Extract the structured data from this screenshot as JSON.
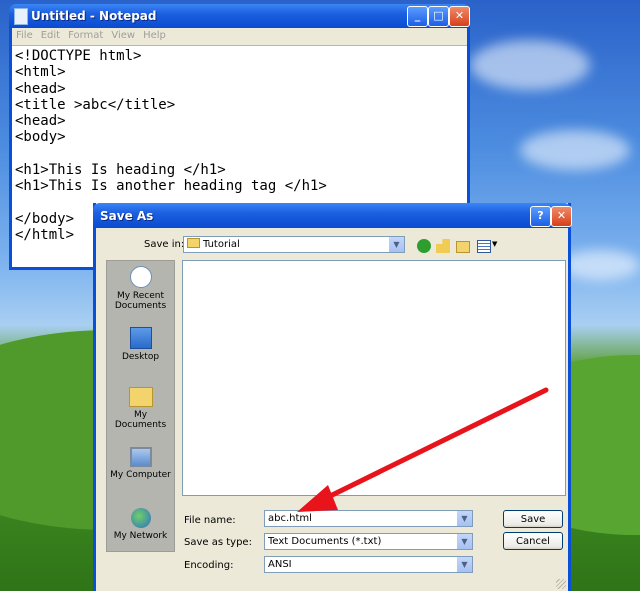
{
  "notepad": {
    "title": "Untitled - Notepad",
    "menu": [
      "File",
      "Edit",
      "Format",
      "View",
      "Help"
    ],
    "content": "<!DOCTYPE html>\n<html>\n<head>\n<title >abc</title>\n<head>\n<body>\n\n<h1>This Is heading </h1>\n<h1>This Is another heading tag </h1>\n\n</body>\n</html>"
  },
  "save_dialog": {
    "title": "Save As",
    "save_in_label": "Save in:",
    "save_in_value": "Tutorial",
    "places": [
      {
        "label": "My Recent Documents",
        "icon": "recent-documents-icon"
      },
      {
        "label": "Desktop",
        "icon": "desktop-icon"
      },
      {
        "label": "My Documents",
        "icon": "my-documents-icon"
      },
      {
        "label": "My Computer",
        "icon": "my-computer-icon"
      },
      {
        "label": "My Network",
        "icon": "my-network-icon"
      }
    ],
    "file_name_label": "File name:",
    "file_name_value": "abc.html",
    "save_as_type_label": "Save as type:",
    "save_as_type_value": "Text Documents (*.txt)",
    "encoding_label": "Encoding:",
    "encoding_value": "ANSI",
    "save_button": "Save",
    "cancel_button": "Cancel",
    "title_buttons": {
      "help": "?",
      "close": "✕"
    }
  },
  "colors": {
    "arrow": "#e8141c",
    "titlebar": "#0a4fd8"
  }
}
